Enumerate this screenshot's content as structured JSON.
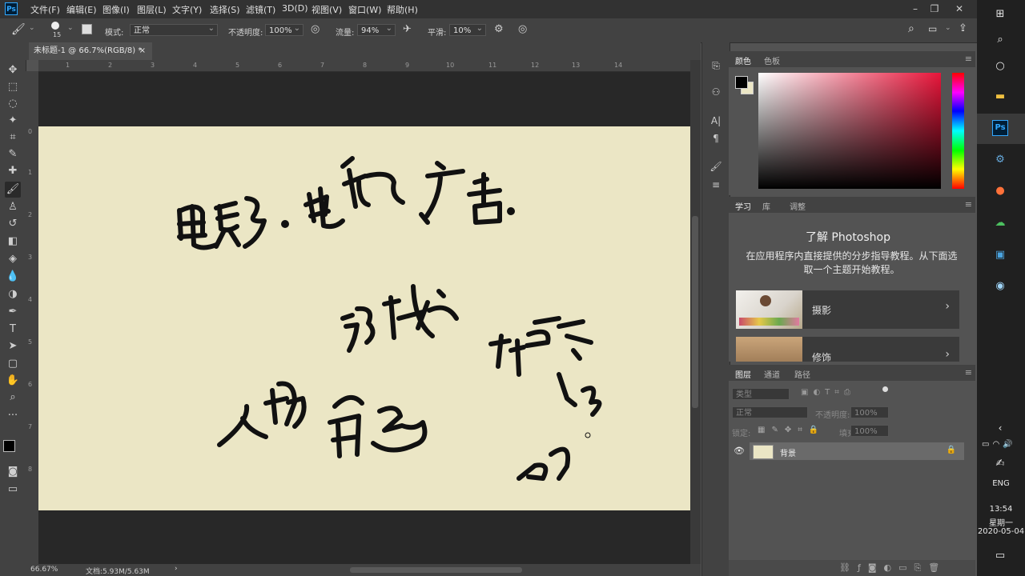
{
  "app": {
    "logo": "Ps"
  },
  "menu": [
    "文件(F)",
    "编辑(E)",
    "图像(I)",
    "图层(L)",
    "文字(Y)",
    "选择(S)",
    "滤镜(T)",
    "3D(D)",
    "视图(V)",
    "窗口(W)",
    "帮助(H)"
  ],
  "options": {
    "brush_size": "15",
    "mode_label": "模式:",
    "mode_value": "正常",
    "opacity_label": "不透明度:",
    "opacity_value": "100%",
    "flow_label": "流量:",
    "flow_value": "94%",
    "smooth_label": "平滑:",
    "smooth_value": "10%"
  },
  "document": {
    "tab_title": "未标题-1 @ 66.7%(RGB/8) *",
    "tab_close": "×"
  },
  "ruler": {
    "h_ticks": [
      "1",
      "2",
      "3",
      "4",
      "5",
      "6",
      "7",
      "8",
      "9",
      "10",
      "11",
      "12",
      "13",
      "14"
    ],
    "v_ticks": [
      "0",
      "1",
      "2",
      "3",
      "4",
      "5",
      "6",
      "7",
      "8"
    ]
  },
  "status": {
    "zoom": "66.67%",
    "doc_info": "文档:5.93M/5.63M",
    "arrow": "›"
  },
  "panels": {
    "color": {
      "tabs": [
        "颜色",
        "色板"
      ]
    },
    "learn": {
      "tabs": [
        "学习",
        "库",
        "调整"
      ],
      "title": "了解 Photoshop",
      "description": "在应用程序内直接提供的分步指导教程。从下面选取一个主题开始教程。",
      "cards": [
        "摄影",
        "修饰"
      ]
    },
    "layers": {
      "tabs": [
        "图层",
        "通道",
        "路径"
      ],
      "filter_placeholder": "类型",
      "blend_mode": "正常",
      "opacity_label": "不透明度:",
      "opacity_value": "100%",
      "lock_label": "锁定:",
      "fill_label": "填充:",
      "fill_value": "100%",
      "layer_name": "背景"
    }
  },
  "taskbar": {
    "lang": "ENG",
    "time": "13:54",
    "weekday": "星期一",
    "date": "2020-05-04"
  },
  "colors": {
    "canvas": "#ebe6c5",
    "accent": "#31a8ff"
  }
}
